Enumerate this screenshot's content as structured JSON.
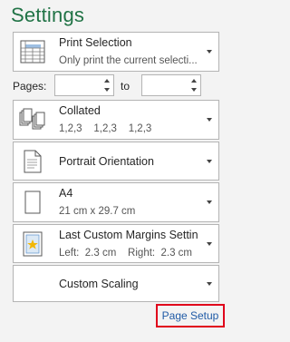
{
  "title": "Settings",
  "print_what": {
    "label": "Print Selection",
    "description": "Only print the current selecti..."
  },
  "pages": {
    "label": "Pages:",
    "from_value": "",
    "to_label": "to",
    "to_value": ""
  },
  "collation": {
    "label": "Collated",
    "description": "1,2,3    1,2,3    1,2,3"
  },
  "orientation": {
    "label": "Portrait Orientation"
  },
  "paper_size": {
    "label": "A4",
    "description": "21 cm x 29.7 cm"
  },
  "margins": {
    "label": "Last Custom Margins Setting",
    "description": "Left:  2.3 cm    Right:  2.3 cm"
  },
  "scaling": {
    "label": "Custom Scaling"
  },
  "page_setup_link": "Page Setup",
  "colors": {
    "title": "#217346",
    "link": "#1f5aa6",
    "highlight_border": "#e0001b"
  }
}
